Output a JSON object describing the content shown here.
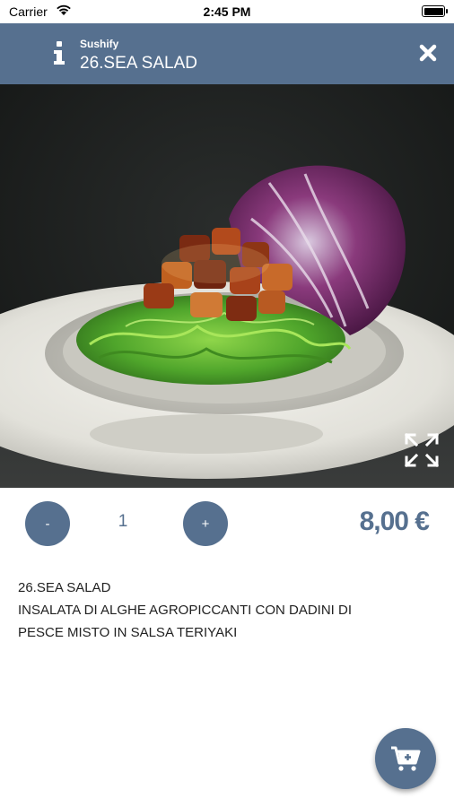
{
  "status_bar": {
    "carrier": "Carrier",
    "time": "2:45 PM"
  },
  "header": {
    "brand": "Sushify",
    "title": "26.SEA SALAD"
  },
  "quantity": {
    "minus_label": "-",
    "value": "1",
    "plus_label": "+"
  },
  "price": "8,00 €",
  "description": {
    "name": "26.SEA SALAD",
    "text": "INSALATA DI ALGHE AGROPICCANTI CON DADINI DI\nPESCE MISTO IN SALSA TERIYAKI"
  },
  "colors": {
    "accent": "#56708f",
    "background": "#ffffff"
  },
  "icons": {
    "info": "info-icon",
    "close": "close-icon",
    "expand": "expand-icon",
    "cart": "add-to-cart-icon"
  }
}
